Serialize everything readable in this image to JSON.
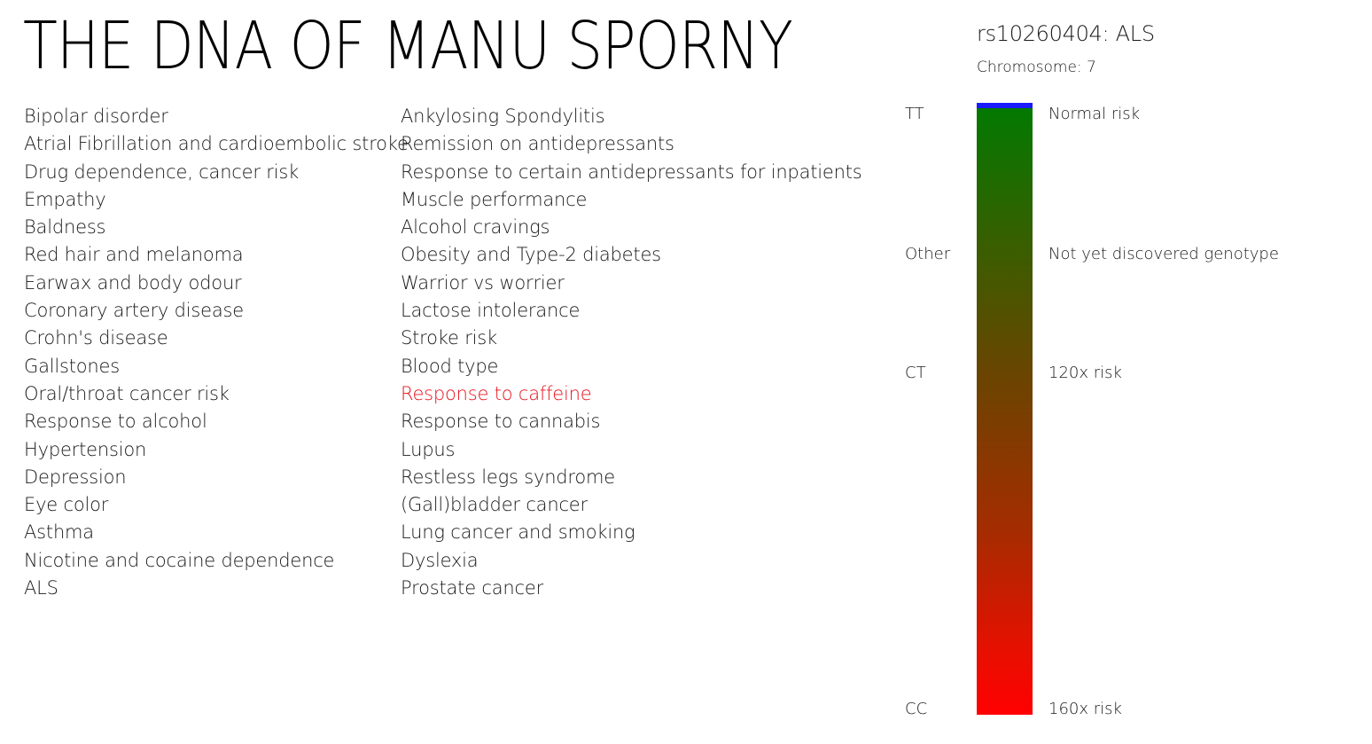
{
  "header": {
    "title": "THE DNA OF MANU SPORNY"
  },
  "traits_left": [
    {
      "label": "Bipolar disorder"
    },
    {
      "label": "Atrial Fibrillation and cardioembolic stroke"
    },
    {
      "label": "Drug dependence, cancer risk"
    },
    {
      "label": "Empathy"
    },
    {
      "label": "Baldness"
    },
    {
      "label": "Red hair and melanoma"
    },
    {
      "label": "Earwax and body odour"
    },
    {
      "label": "Coronary artery disease"
    },
    {
      "label": "Crohn's disease"
    },
    {
      "label": "Gallstones"
    },
    {
      "label": "Oral/throat cancer risk"
    },
    {
      "label": "Response to alcohol"
    },
    {
      "label": "Hypertension"
    },
    {
      "label": "Depression"
    },
    {
      "label": "Eye color"
    },
    {
      "label": "Asthma"
    },
    {
      "label": "Nicotine and cocaine dependence"
    },
    {
      "label": "ALS"
    }
  ],
  "traits_right": [
    {
      "label": "Ankylosing Spondylitis"
    },
    {
      "label": "Remission on antidepressants"
    },
    {
      "label": "Response to certain antidepressants for inpatients"
    },
    {
      "label": "Muscle performance"
    },
    {
      "label": "Alcohol cravings"
    },
    {
      "label": "Obesity and Type-2 diabetes"
    },
    {
      "label": "Warrior vs worrier"
    },
    {
      "label": "Lactose intolerance"
    },
    {
      "label": "Stroke risk"
    },
    {
      "label": "Blood type"
    },
    {
      "label": "Response to caffeine",
      "highlighted": true
    },
    {
      "label": "Response to cannabis"
    },
    {
      "label": "Lupus"
    },
    {
      "label": "Restless legs syndrome"
    },
    {
      "label": "(Gall)bladder cancer"
    },
    {
      "label": "Lung cancer and smoking"
    },
    {
      "label": "Dyslexia"
    },
    {
      "label": "Prostate cancer"
    }
  ],
  "detail": {
    "snp_title": "rs10260404: ALS",
    "chromosome_label": "Chromosome:",
    "chromosome_value": "7",
    "genotypes": [
      {
        "genotype": "TT",
        "risk": "Normal risk"
      },
      {
        "genotype": "Other",
        "risk": "Not yet discovered genotype"
      },
      {
        "genotype": "CT",
        "risk": "120x risk"
      },
      {
        "genotype": "CC",
        "risk": "160x risk"
      }
    ]
  },
  "colors": {
    "highlight_text": "#e8121c",
    "bar_top_cap": "#1a1aff",
    "bar_low_risk": "#007a00",
    "bar_high_risk": "#ff0000"
  }
}
